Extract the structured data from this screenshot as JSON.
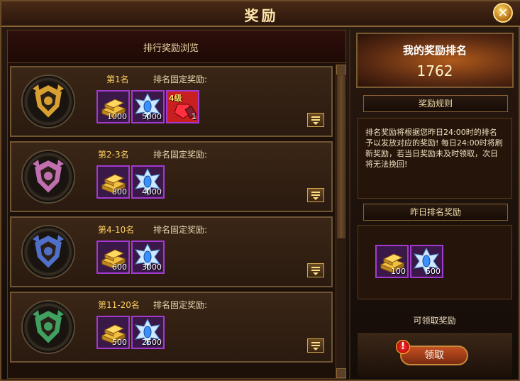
{
  "window": {
    "title": "奖励"
  },
  "left_panel": {
    "title": "排行奖励浏览",
    "fixed_reward_label": "排名固定奖励:",
    "rows": [
      {
        "rank": "第1名",
        "rank_color": "#ffd060",
        "medal_color": "#d8a030",
        "items": [
          {
            "type": "gold",
            "qty": "1000"
          },
          {
            "type": "gem",
            "qty": "5000"
          },
          {
            "type": "red-badge",
            "tag": "4级",
            "qty": "1"
          }
        ]
      },
      {
        "rank": "第2-3名",
        "rank_color": "#ffd060",
        "medal_color": "#c070b0",
        "items": [
          {
            "type": "gold",
            "qty": "800"
          },
          {
            "type": "gem",
            "qty": "4000"
          }
        ]
      },
      {
        "rank": "第4-10名",
        "rank_color": "#ffd060",
        "medal_color": "#5070c8",
        "items": [
          {
            "type": "gold",
            "qty": "600"
          },
          {
            "type": "gem",
            "qty": "3000"
          }
        ]
      },
      {
        "rank": "第11-20名",
        "rank_color": "#ffd060",
        "medal_color": "#40a060",
        "items": [
          {
            "type": "gold",
            "qty": "500"
          },
          {
            "type": "gem",
            "qty": "2500"
          }
        ]
      }
    ]
  },
  "right_panel": {
    "banner_title": "我的奖励排名",
    "my_rank": "1762",
    "rules_header": "奖励规则",
    "rules_text": "排名奖励将根据您昨日24:00时的排名予以发放对应的奖励! 每日24:00时将刷新奖励，若当日奖励未及时领取，次日将无法挽回!",
    "yesterday_header": "昨日排名奖励",
    "yesterday_items": [
      {
        "type": "gold",
        "qty": "100"
      },
      {
        "type": "gem",
        "qty": "500"
      }
    ],
    "can_claim_text": "可领取奖励",
    "claim_button": "领取",
    "alert_mark": "!"
  }
}
